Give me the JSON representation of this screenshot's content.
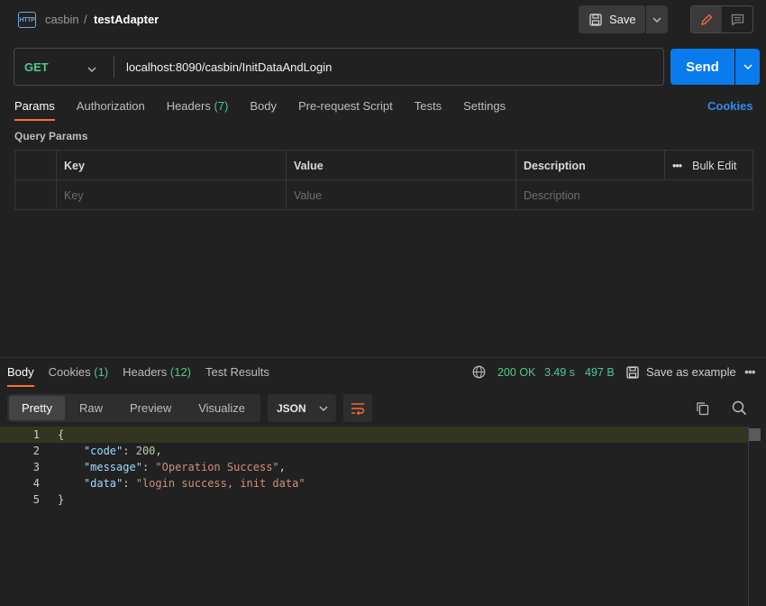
{
  "header": {
    "icon_label": "HTTP",
    "collection": "casbin",
    "separator": "/",
    "request_name": "testAdapter",
    "save_label": "Save"
  },
  "request": {
    "method": "GET",
    "url": "localhost:8090/casbin/InitDataAndLogin",
    "send_label": "Send"
  },
  "request_tabs": [
    {
      "label": "Params",
      "count": ""
    },
    {
      "label": "Authorization",
      "count": ""
    },
    {
      "label": "Headers",
      "count": "(7)"
    },
    {
      "label": "Body",
      "count": ""
    },
    {
      "label": "Pre-request Script",
      "count": ""
    },
    {
      "label": "Tests",
      "count": ""
    },
    {
      "label": "Settings",
      "count": ""
    }
  ],
  "cookies_link": "Cookies",
  "query_params": {
    "title": "Query Params",
    "columns": [
      "Key",
      "Value",
      "Description"
    ],
    "bulk_edit": "Bulk Edit",
    "placeholders": [
      "Key",
      "Value",
      "Description"
    ]
  },
  "response_tabs": [
    {
      "label": "Body",
      "count": ""
    },
    {
      "label": "Cookies",
      "count": "(1)"
    },
    {
      "label": "Headers",
      "count": "(12)"
    },
    {
      "label": "Test Results",
      "count": ""
    }
  ],
  "response_status": {
    "status": "200 OK",
    "time": "3.49 s",
    "size": "497 B",
    "save_example": "Save as example"
  },
  "view_modes": [
    "Pretty",
    "Raw",
    "Preview",
    "Visualize"
  ],
  "format": "JSON",
  "code_lines": [
    {
      "n": "1",
      "text": "{"
    },
    {
      "n": "2",
      "key": "\"code\"",
      "value": "200",
      "type": "n",
      "suffix": ","
    },
    {
      "n": "3",
      "key": "\"message\"",
      "value": "\"Operation Success\"",
      "type": "s",
      "suffix": ","
    },
    {
      "n": "4",
      "key": "\"data\"",
      "value": "\"login success, init data\"",
      "type": "s",
      "suffix": ""
    },
    {
      "n": "5",
      "text": "}"
    }
  ],
  "colors": {
    "accent": "#ff6c37",
    "send": "#097bed",
    "success": "#4ec98f"
  }
}
